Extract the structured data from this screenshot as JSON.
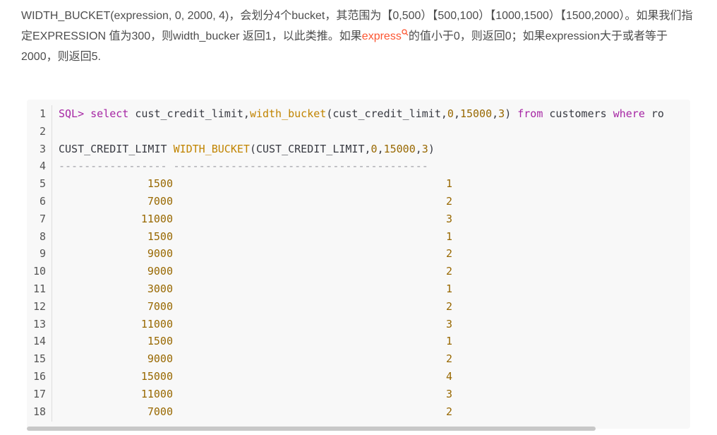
{
  "paragraph": {
    "part1": "WIDTH_BUCKET(expression, 0, 2000, 4)，会划分4个bucket，其范围为【0,500）【500,100）【1000,1500）【1500,2000）。如果我们指定EXPRESSION 值为300，则width_bucker 返回1，以此类推。如果",
    "link": "express",
    "part2": "的值小于0，则返回0；如果expression大于或者等于2000，则返回5."
  },
  "code": {
    "line_numbers": [
      "1",
      "2",
      "3",
      "4",
      "5",
      "6",
      "7",
      "8",
      "9",
      "10",
      "11",
      "12",
      "13",
      "14",
      "15",
      "16",
      "17",
      "18"
    ],
    "query": {
      "prompt": "SQL>",
      "select": "select",
      "col": " cust_credit_limit,",
      "fn": "width_bucket",
      "args_a": "(cust_credit_limit,",
      "zero": "0",
      "comma1": ",",
      "max": "15000",
      "comma2": ",",
      "n": "3",
      "close": ")",
      "from": "from",
      "table": "customers",
      "where": "where",
      "rest": "ro"
    },
    "header": {
      "col1": "CUST_CREDIT_LIMIT ",
      "fn": "WIDTH_BUCKET",
      "args": "(CUST_CREDIT_LIMIT,",
      "zero": "0",
      "c1": ",",
      "max": "15000",
      "c2": ",",
      "n": "3",
      "close": ")"
    },
    "separator": "----------------- ----------------------------------------",
    "rows": [
      [
        "1500",
        "1"
      ],
      [
        "7000",
        "2"
      ],
      [
        "11000",
        "3"
      ],
      [
        "1500",
        "1"
      ],
      [
        "9000",
        "2"
      ],
      [
        "9000",
        "2"
      ],
      [
        "3000",
        "1"
      ],
      [
        "7000",
        "2"
      ],
      [
        "11000",
        "3"
      ],
      [
        "1500",
        "1"
      ],
      [
        "9000",
        "2"
      ],
      [
        "15000",
        "4"
      ],
      [
        "11000",
        "3"
      ],
      [
        "7000",
        "2"
      ]
    ]
  }
}
